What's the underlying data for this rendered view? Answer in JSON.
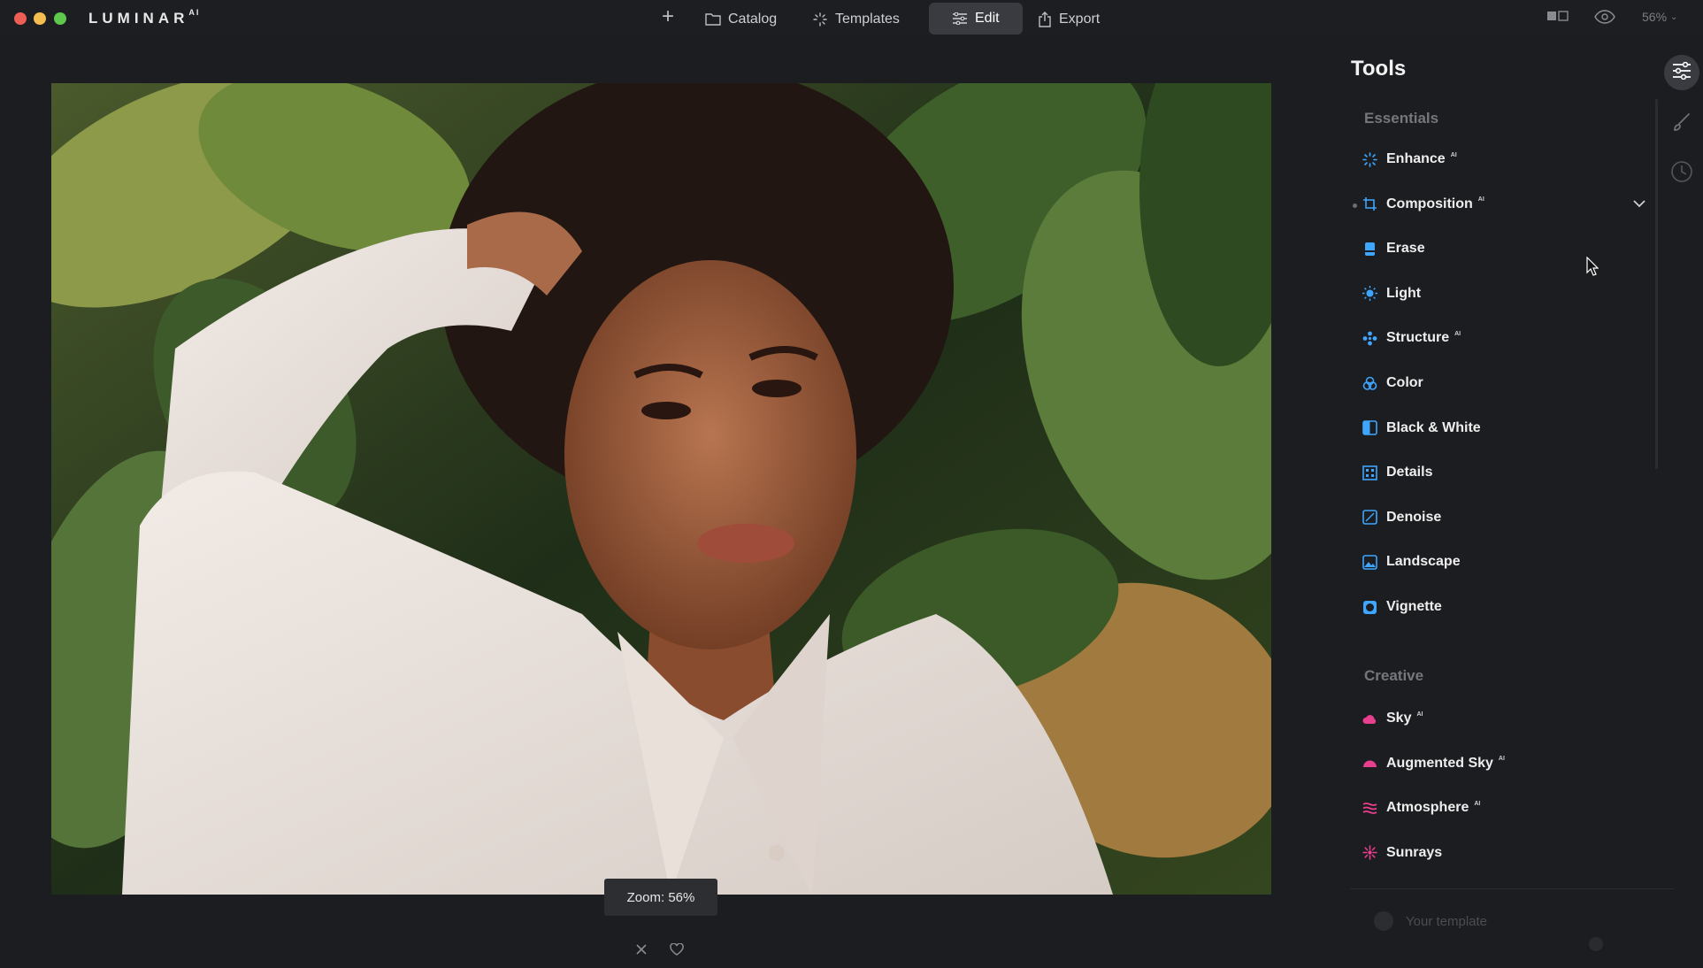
{
  "app": {
    "brand": "LUMINAR",
    "brand_suffix": "AI"
  },
  "nav": {
    "catalog": "Catalog",
    "templates": "Templates",
    "edit": "Edit",
    "export": "Export"
  },
  "topbar_right": {
    "zoom": "56%"
  },
  "canvas": {
    "zoom_label": "Zoom: 56%"
  },
  "tools": {
    "title": "Tools",
    "essentials_label": "Essentials",
    "essentials": [
      {
        "label": "Enhance",
        "ai": "AI",
        "icon": "enhance-icon",
        "color": "#3ea6ff"
      },
      {
        "label": "Composition",
        "ai": "AI",
        "icon": "crop-icon",
        "color": "#3ea6ff"
      },
      {
        "label": "Erase",
        "ai": "",
        "icon": "erase-icon",
        "color": "#3ea6ff"
      },
      {
        "label": "Light",
        "ai": "",
        "icon": "sun-icon",
        "color": "#3ea6ff"
      },
      {
        "label": "Structure",
        "ai": "AI",
        "icon": "structure-icon",
        "color": "#3ea6ff"
      },
      {
        "label": "Color",
        "ai": "",
        "icon": "color-icon",
        "color": "#3ea6ff"
      },
      {
        "label": "Black & White",
        "ai": "",
        "icon": "bw-icon",
        "color": "#3ea6ff"
      },
      {
        "label": "Details",
        "ai": "",
        "icon": "details-icon",
        "color": "#3ea6ff"
      },
      {
        "label": "Denoise",
        "ai": "",
        "icon": "denoise-icon",
        "color": "#3ea6ff"
      },
      {
        "label": "Landscape",
        "ai": "",
        "icon": "landscape-icon",
        "color": "#3ea6ff"
      },
      {
        "label": "Vignette",
        "ai": "",
        "icon": "vignette-icon",
        "color": "#3ea6ff"
      }
    ],
    "creative_label": "Creative",
    "creative": [
      {
        "label": "Sky",
        "ai": "AI",
        "icon": "sky-icon",
        "color": "#ea3f8f"
      },
      {
        "label": "Augmented Sky",
        "ai": "AI",
        "icon": "augmented-sky-icon",
        "color": "#ea3f8f"
      },
      {
        "label": "Atmosphere",
        "ai": "AI",
        "icon": "atmosphere-icon",
        "color": "#ea3f8f"
      },
      {
        "label": "Sunrays",
        "ai": "",
        "icon": "sunrays-icon",
        "color": "#ea3f8f"
      }
    ],
    "template_placeholder": "Your template"
  }
}
